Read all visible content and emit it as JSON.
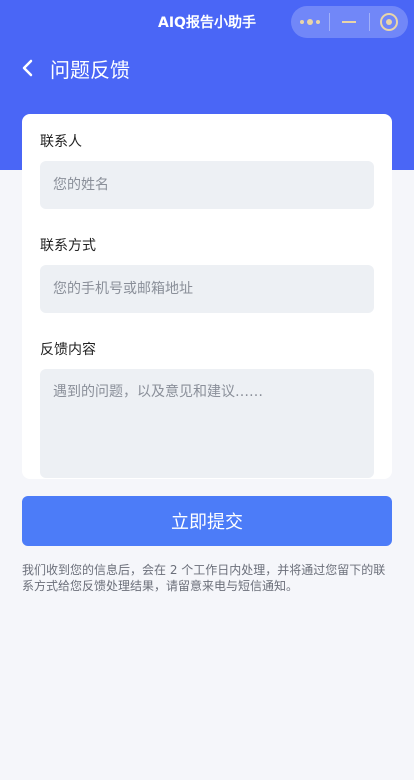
{
  "app": {
    "title": "AIQ报告小助手"
  },
  "capsule": {
    "more_icon": "more-dots-icon",
    "minimize_icon": "minimize-icon",
    "close_icon": "close-circle-icon"
  },
  "nav": {
    "back_icon": "chevron-left-icon",
    "title": "问题反馈"
  },
  "form": {
    "contact_name": {
      "label": "联系人",
      "placeholder": "您的姓名",
      "value": ""
    },
    "contact_method": {
      "label": "联系方式",
      "placeholder": "您的手机号或邮箱地址",
      "value": ""
    },
    "content": {
      "label": "反馈内容",
      "placeholder": "遇到的问题，以及意见和建议……",
      "value": ""
    }
  },
  "submit": {
    "label": "立即提交"
  },
  "notice": "我们收到您的信息后，会在 2 个工作日内处理，并将通过您留下的联系方式给您反馈处理结果，请留意来电与短信通知。",
  "colors": {
    "primary": "#4a66f6",
    "button": "#4c7cf8",
    "page_bg": "#f5f6fa",
    "input_bg": "#edf0f4"
  }
}
